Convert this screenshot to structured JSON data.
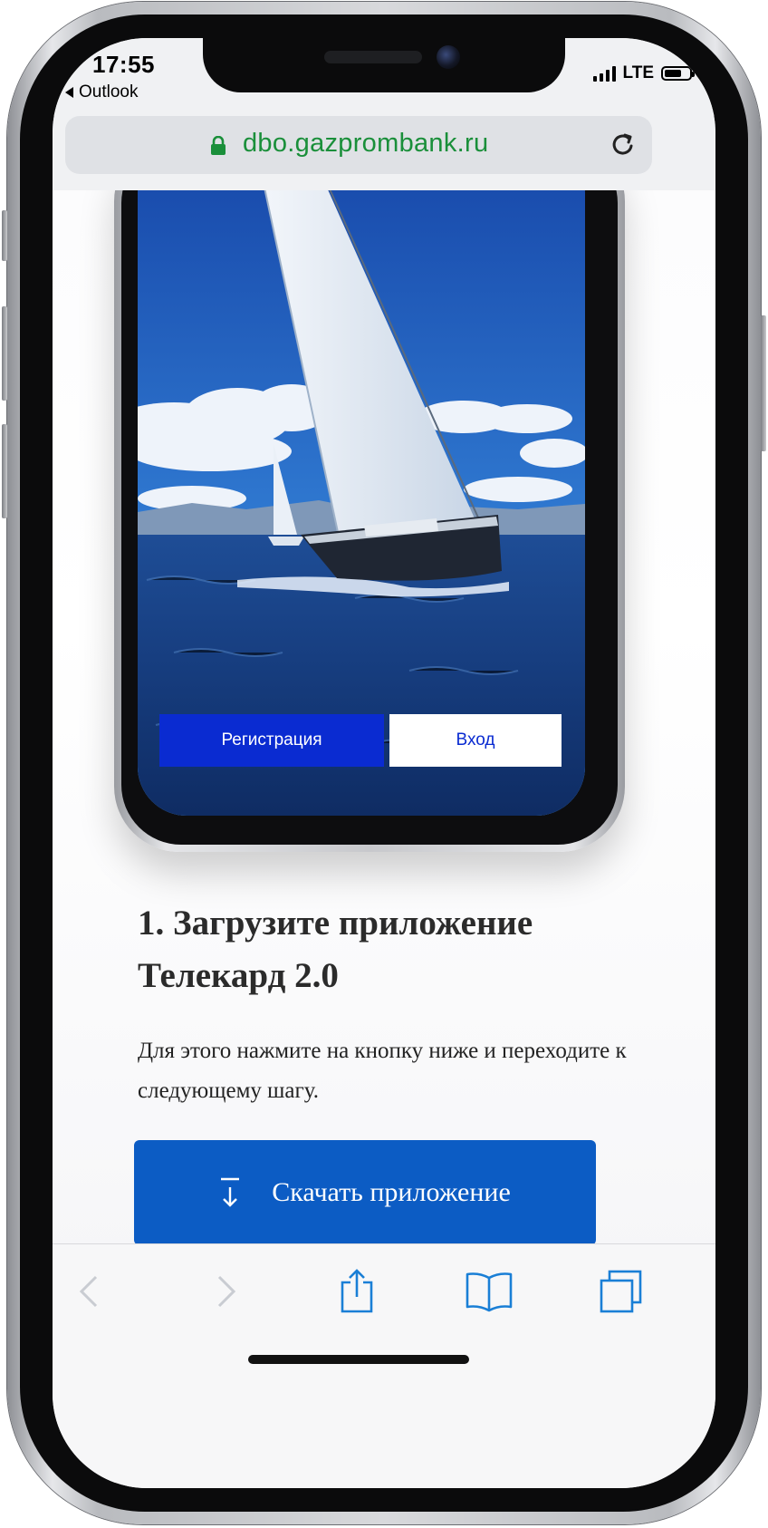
{
  "status_bar": {
    "time": "17:55",
    "back_app": "Outlook",
    "network": "LTE",
    "battery_level": 0.7
  },
  "browser": {
    "url": "dbo.gazprombank.ru",
    "lock_icon": "lock-icon",
    "reload_icon": "reload-icon"
  },
  "promo": {
    "register_label": "Регистрация",
    "login_label": "Вход"
  },
  "content": {
    "step_title": "1. Загрузите приложение Телекард 2.0",
    "step_description": "Для этого нажмите на кнопку ниже и переходите к следующему шагу.",
    "download_label": "Скачать приложение"
  },
  "toolbar": {
    "items": [
      "back-icon",
      "forward-icon",
      "share-icon",
      "bookmarks-icon",
      "tabs-icon"
    ]
  },
  "colors": {
    "url_green": "#1a8f3a",
    "accent_blue": "#0c5cc4",
    "promo_blue": "#0a2bd1",
    "toolbar_icon": "#1a7fd6"
  }
}
